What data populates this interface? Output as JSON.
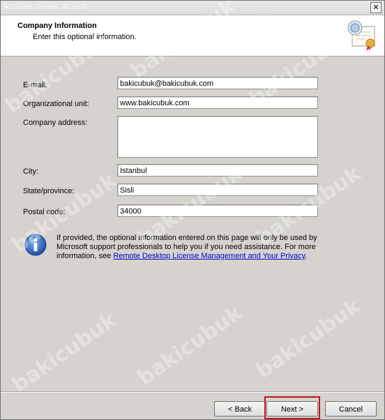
{
  "window": {
    "title": "Activate Server Wizard",
    "close_glyph": "✕"
  },
  "header": {
    "title": "Company Information",
    "subtitle": "Enter this optional information.",
    "icon": "certificate-icon"
  },
  "form": {
    "email": {
      "label": "E-mail:",
      "value": "bakicubuk@bakicubuk.com"
    },
    "org_unit": {
      "label": "Organizational unit:",
      "value": "www.bakicubuk.com"
    },
    "address": {
      "label": "Company address:",
      "value": ""
    },
    "city": {
      "label": "City:",
      "value": "Istanbul"
    },
    "state": {
      "label": "State/province:",
      "value": "Sisli"
    },
    "postal": {
      "label": "Postal code:",
      "value": "34000"
    }
  },
  "info": {
    "icon": "info-icon",
    "text_before": "If provided, the optional information entered on this page will only be used by Microsoft support professionals to help you if you need assistance. For more information, see ",
    "link": "Remote Desktop License Management and Your Privacy",
    "text_after": "."
  },
  "buttons": {
    "back": "< Back",
    "next": "Next >",
    "cancel": "Cancel"
  },
  "watermark": "bakicubuk",
  "colors": {
    "highlight": "#c0141a",
    "link": "#0000cc",
    "dialog_bg": "#d6d3ce"
  }
}
